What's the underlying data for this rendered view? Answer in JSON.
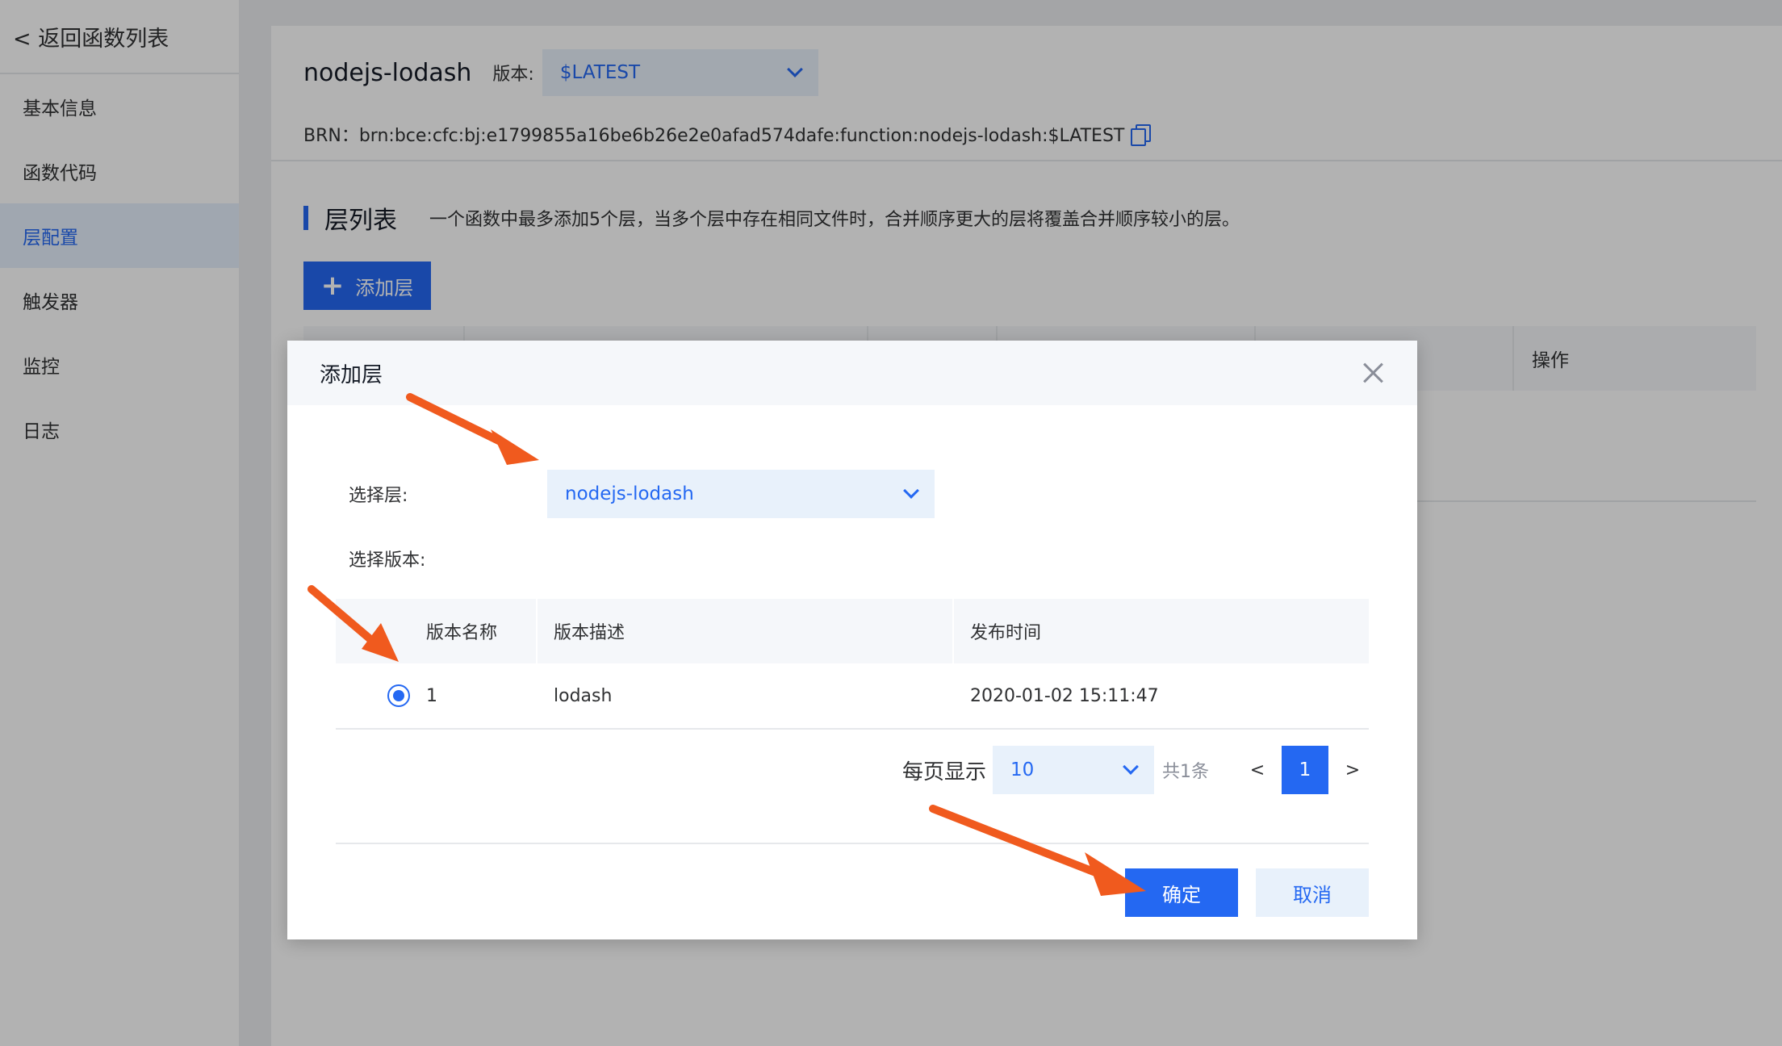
{
  "sidebar": {
    "back_label": "< 返回函数列表",
    "items": [
      {
        "label": "基本信息"
      },
      {
        "label": "函数代码"
      },
      {
        "label": "层配置"
      },
      {
        "label": "触发器"
      },
      {
        "label": "监控"
      },
      {
        "label": "日志"
      }
    ],
    "active_item": "层配置"
  },
  "function": {
    "name": "nodejs-lodash",
    "version_label": "版本:",
    "version_value": "$LATEST",
    "brn": "BRN：brn:bce:cfc:bj:e1799855a16be6b26e2e0afad574dafe:function:nodejs-lodash:$LATEST"
  },
  "layers_section": {
    "title": "层列表",
    "description": "一个函数中最多添加5个层，当多个层中存在相同文件时，合并顺序更大的层将覆盖合并顺序较小的层。",
    "add_button": "添加层",
    "table_op_header": "操作"
  },
  "modal": {
    "title": "添加层",
    "select_layer_label": "选择层:",
    "select_layer_value": "nodejs-lodash",
    "select_version_label": "选择版本:",
    "table": {
      "headers": [
        "版本名称",
        "版本描述",
        "发布时间"
      ],
      "rows": [
        {
          "name": "1",
          "description": "lodash",
          "published": "2020-01-02 15:11:47",
          "selected": true
        }
      ]
    },
    "pager": {
      "per_page_label": "每页显示",
      "per_page_value": "10",
      "total": "共1条",
      "prev": "<",
      "current": "1",
      "next": ">"
    },
    "confirm": "确定",
    "cancel": "取消"
  },
  "colors": {
    "primary": "#2468f2",
    "annotation_arrow": "#f05a1e"
  }
}
